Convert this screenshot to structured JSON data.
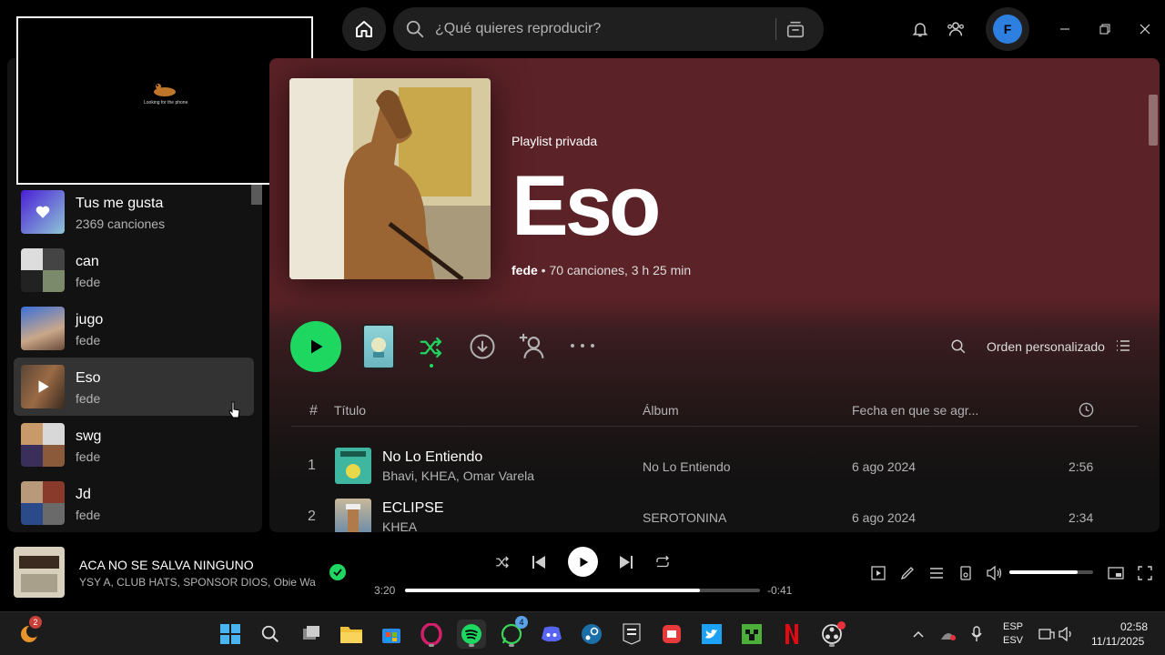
{
  "search": {
    "placeholder": "¿Qué quieres reproducir?"
  },
  "profile": {
    "initial": "F",
    "color": "#2d7fe0"
  },
  "pip": {
    "caption": "Looking for the phone"
  },
  "library": {
    "items": [
      {
        "name": "Tus me gusta",
        "sub": "2369 canciones",
        "active": false
      },
      {
        "name": "can",
        "sub": "fede",
        "active": false
      },
      {
        "name": "jugo",
        "sub": "fede",
        "active": false
      },
      {
        "name": "Eso",
        "sub": "fede",
        "active": true
      },
      {
        "name": "swg",
        "sub": "fede",
        "active": false
      },
      {
        "name": "Jd",
        "sub": "fede",
        "active": false
      }
    ]
  },
  "playlist": {
    "kind": "Playlist privada",
    "title": "Eso",
    "owner": "fede",
    "details": " • 70 canciones, 3 h 25 min"
  },
  "actions": {
    "order_label": "Orden personalizado"
  },
  "table": {
    "headers": {
      "num": "#",
      "title": "Título",
      "album": "Álbum",
      "date": "Fecha en que se agr..."
    },
    "rows": [
      {
        "num": "1",
        "title": "No Lo Entiendo",
        "artists": "Bhavi, KHEA, Omar Varela",
        "album": "No Lo Entiendo",
        "date": "6 ago 2024",
        "duration": "2:56"
      },
      {
        "num": "2",
        "title": "ECLIPSE",
        "artists": "KHEA",
        "album": "SEROTONINA",
        "date": "6 ago 2024",
        "duration": "2:34"
      }
    ]
  },
  "now_playing": {
    "title": "ACA NO SE SALVA NINGUNO",
    "artists": "YSY A, CLUB HATS, SPONSOR DIOS, Obie Wanshot",
    "elapsed": "3:20",
    "remaining": "-0:41",
    "progress": 0.83,
    "volume": 0.82
  },
  "taskbar": {
    "weather_badge": "2",
    "whatsapp_badge": "4",
    "lang_top": "ESP",
    "lang_bottom": "ESV",
    "time": "02:58",
    "date": "11/11/2025"
  },
  "colors": {
    "accent": "#1ed760",
    "header_bg": "#5b2227"
  }
}
